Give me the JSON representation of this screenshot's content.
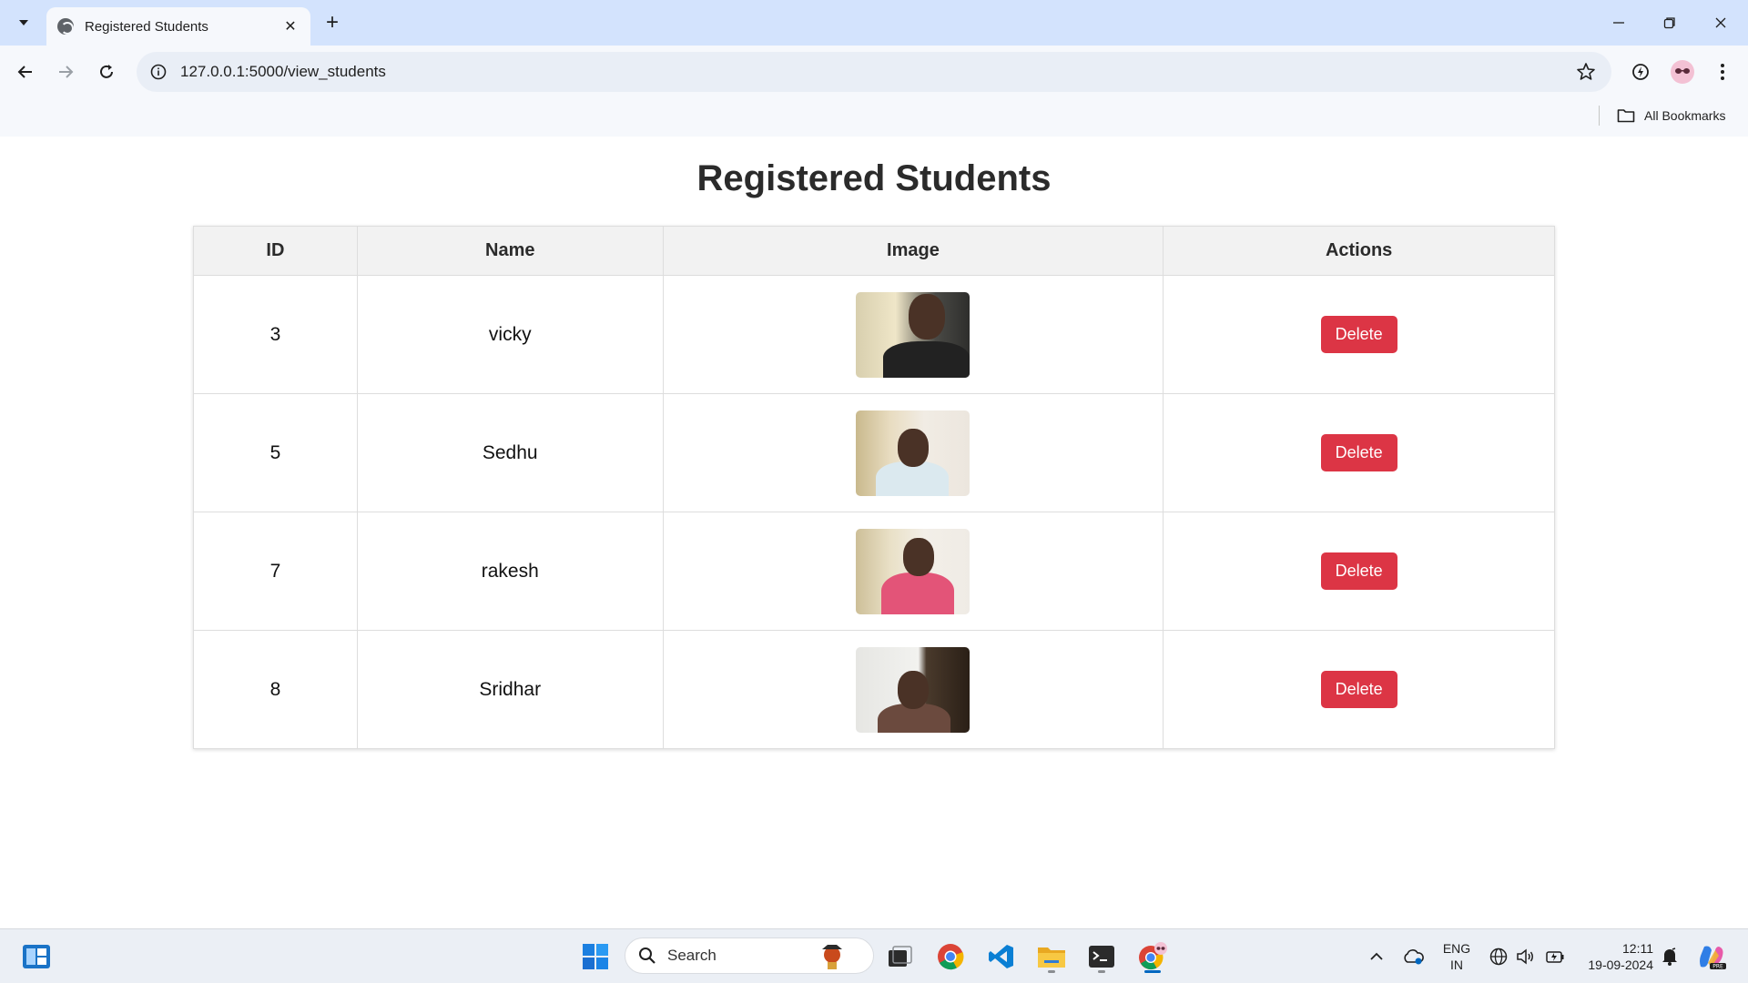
{
  "browser": {
    "tab_title": "Registered Students",
    "url": "127.0.0.1:5000/view_students",
    "bookmarks_label": "All Bookmarks"
  },
  "page": {
    "heading": "Registered Students",
    "columns": [
      "ID",
      "Name",
      "Image",
      "Actions"
    ],
    "rows": [
      {
        "id": "3",
        "name": "vicky",
        "action": "Delete"
      },
      {
        "id": "5",
        "name": "Sedhu",
        "action": "Delete"
      },
      {
        "id": "7",
        "name": "rakesh",
        "action": "Delete"
      },
      {
        "id": "8",
        "name": "Sridhar",
        "action": "Delete"
      }
    ],
    "delete_color": "#dc3545"
  },
  "taskbar": {
    "search_placeholder": "Search",
    "language_line1": "ENG",
    "language_line2": "IN",
    "time": "12:11",
    "date": "19-09-2024"
  }
}
